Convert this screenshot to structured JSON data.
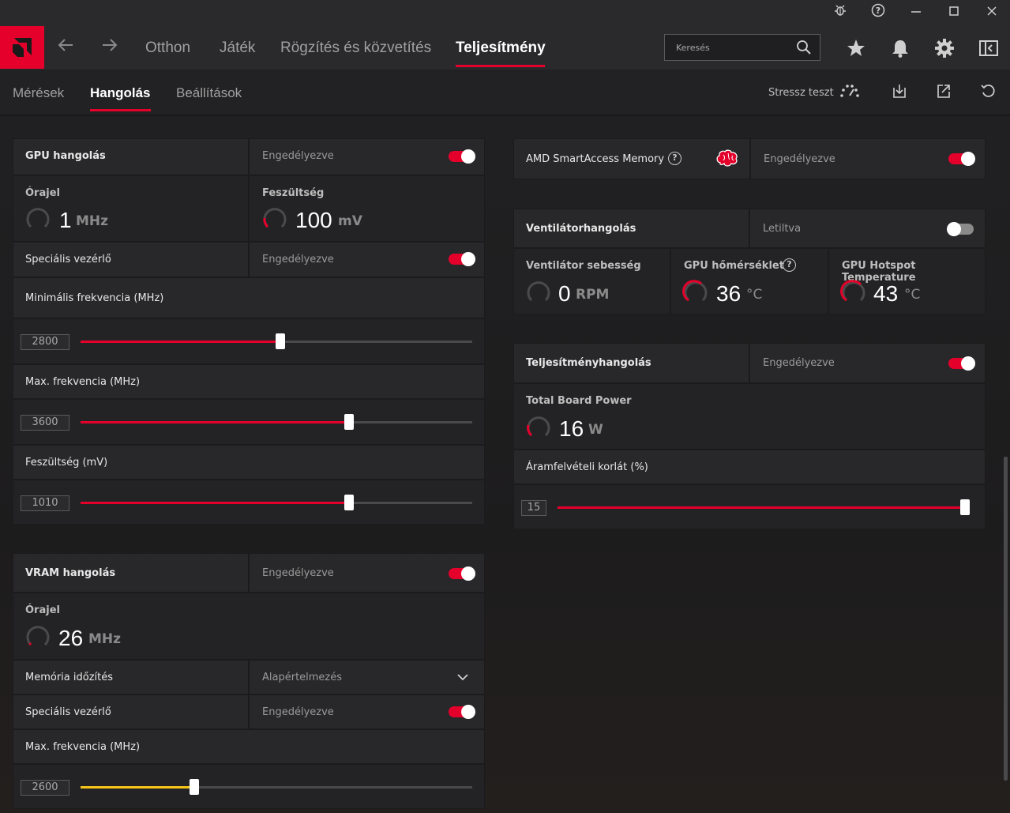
{
  "nav": {
    "tabs": [
      "Otthon",
      "Játék",
      "Rögzítés és közvetítés",
      "Teljesítmény"
    ],
    "search_placeholder": "Keresés"
  },
  "subnav": {
    "tabs": [
      "Mérések",
      "Hangolás",
      "Beállítások"
    ],
    "stress_label": "Stressz teszt"
  },
  "gpu_tuning": {
    "title": "GPU hangolás",
    "status": "Engedélyezve",
    "clock_label": "Órajel",
    "clock_value": "1",
    "clock_unit": "MHz",
    "voltage_label": "Feszültség",
    "voltage_value": "100",
    "voltage_unit": "mV",
    "advanced_label": "Speciális vezérlő",
    "advanced_status": "Engedélyezve",
    "min_freq_label": "Minimális frekvencia (MHz)",
    "min_freq_value": "2800",
    "min_freq_fraction": 0.51,
    "max_freq_label": "Max. frekvencia (MHz)",
    "max_freq_value": "3600",
    "max_freq_fraction": 0.685,
    "volt_label": "Feszültség (mV)",
    "volt_value": "1010",
    "volt_fraction": 0.685
  },
  "vram_tuning": {
    "title": "VRAM hangolás",
    "status": "Engedélyezve",
    "clock_label": "Órajel",
    "clock_value": "26",
    "clock_unit": "MHz",
    "timing_label": "Memória időzítés",
    "timing_value": "Alapértelmezés",
    "advanced_label": "Speciális vezérlő",
    "advanced_status": "Engedélyezve",
    "max_freq_label": "Max. frekvencia (MHz)",
    "max_freq_value": "2600",
    "max_freq_fraction": 0.29
  },
  "sam": {
    "label": "AMD SmartAccess Memory",
    "status": "Engedélyezve"
  },
  "fan": {
    "title": "Ventilátorhangolás",
    "status": "Letiltva",
    "speed_label": "Ventilátor sebesség",
    "speed_value": "0",
    "speed_unit": "RPM",
    "temp_label": "GPU hőmérséklet",
    "temp_value": "36",
    "temp_unit": "°C",
    "hotspot_label": "GPU Hotspot Temperature",
    "hotspot_value": "43",
    "hotspot_unit": "°C"
  },
  "power": {
    "title": "Teljesítményhangolás",
    "status": "Engedélyezve",
    "tbp_label": "Total Board Power",
    "tbp_value": "16",
    "tbp_unit": "W",
    "limit_label": "Áramfelvételi korlát (%)",
    "limit_value": "15",
    "limit_fraction": 1.0
  },
  "colors": {
    "accent": "#e4002b",
    "vram_slider": "#f5c518"
  }
}
